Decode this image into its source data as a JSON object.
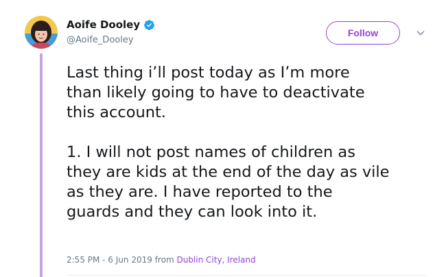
{
  "user": {
    "display_name": "Aoife Dooley",
    "handle": "@Aoife_Dooley",
    "verified_icon": "verified-badge-icon",
    "avatar_icon": "avatar"
  },
  "actions": {
    "follow_label": "Follow",
    "more_icon": "chevron-down-icon"
  },
  "tweet": {
    "text": "Last thing i’ll post today as I’m more\nthan likely going to have to deactivate\nthis account.\n\n1. I will not post names of children as\nthey are kids at the end of the day as vile\nas they are. I have reported to the\nguards and they can look into it.",
    "time_date": "2:55 PM - 6 Jun 2019",
    "from_label": "from",
    "location": "Dublin City, Ireland"
  },
  "colors": {
    "accent": "#8f44d6",
    "verified": "#1da1f2",
    "thread_line": "#c9a3e0",
    "secondary_text": "#657786"
  }
}
